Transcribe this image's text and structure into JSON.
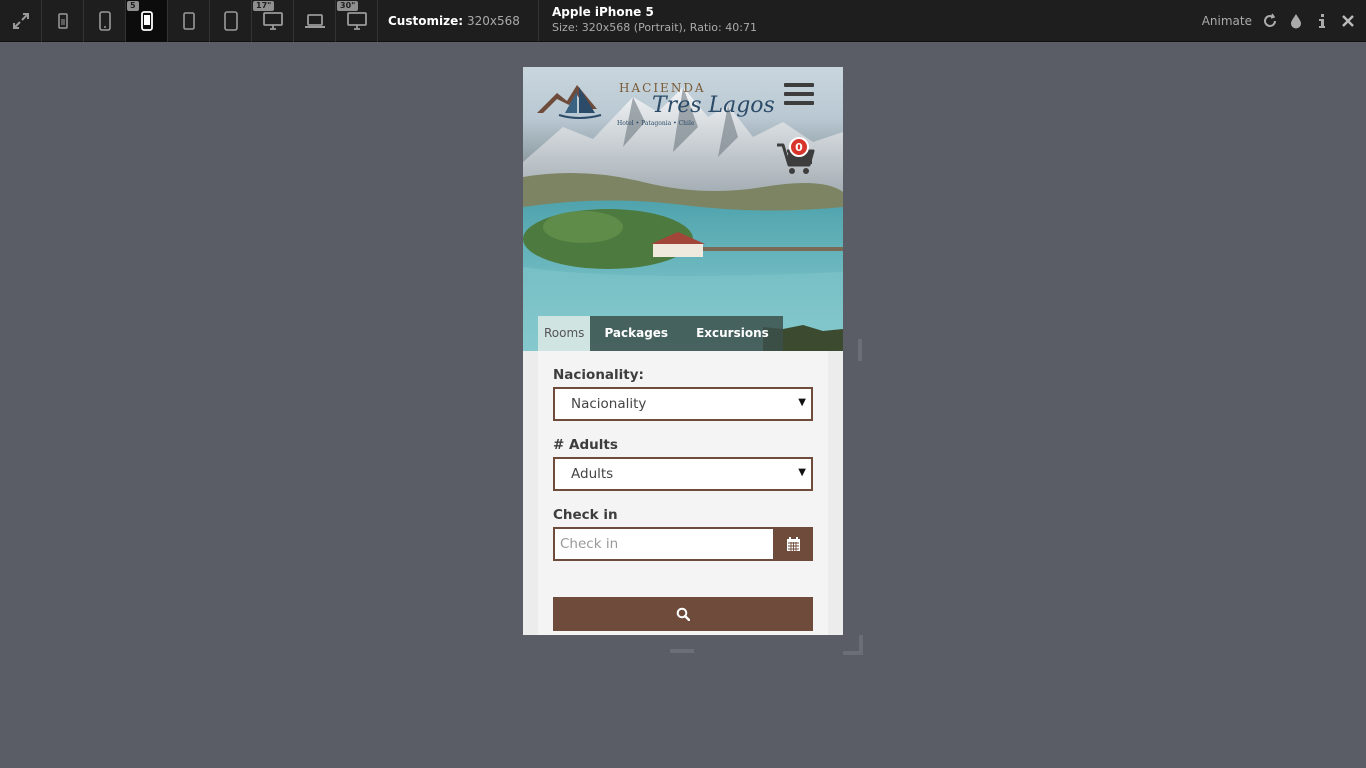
{
  "toolbar": {
    "device_buttons": [
      {
        "name": "fullscreen-icon",
        "badge": ""
      },
      {
        "name": "phone-small-icon",
        "badge": ""
      },
      {
        "name": "phone-icon",
        "badge": ""
      },
      {
        "name": "phone-active-icon",
        "badge": "5"
      },
      {
        "name": "tablet-small-icon",
        "badge": ""
      },
      {
        "name": "tablet-icon",
        "badge": ""
      },
      {
        "name": "monitor-17-icon",
        "badge": "17\""
      },
      {
        "name": "laptop-icon",
        "badge": ""
      },
      {
        "name": "monitor-30-icon",
        "badge": "30\""
      }
    ],
    "customize_label": "Customize:",
    "customize_dims": "320x568",
    "device_name": "Apple iPhone 5",
    "device_size": "Size: 320x568 (Portrait), Ratio: 40:71",
    "animate_label": "Animate"
  },
  "site": {
    "logo_top": "HACIENDA",
    "logo_main": "Tres Lagos",
    "logo_sub": "Hotel • Patagonia • Chile",
    "cart_count": "0",
    "tabs": [
      {
        "label": "Rooms",
        "active": true
      },
      {
        "label": "Packages",
        "active": false
      },
      {
        "label": "Excursions",
        "active": false
      }
    ],
    "form": {
      "nationality_label": "Nacionality:",
      "nationality_value": "Nacionality",
      "adults_label": "# Adults",
      "adults_value": "Adults",
      "checkin_label": "Check in",
      "checkin_placeholder": "Check in"
    }
  },
  "colors": {
    "accent_brown": "#6e4b3a",
    "badge_red": "#d9342b",
    "toolbar_bg": "#1e1e1e",
    "workspace_bg": "#5a5d65"
  }
}
